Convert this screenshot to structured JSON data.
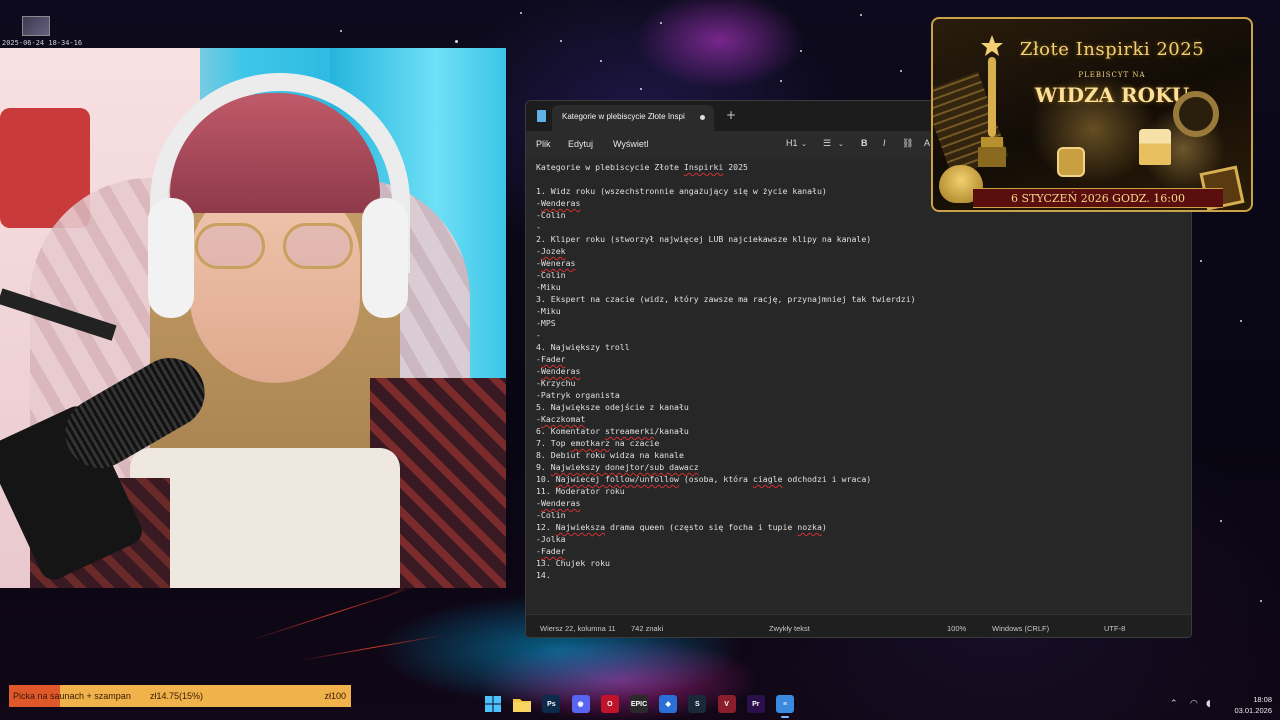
{
  "recording": {
    "timestamp": "2025-06-24 18-34-16"
  },
  "notepad": {
    "tab_title": "Kategorie w plebiscycie Złote Inspi",
    "new_tab": "+",
    "menu": {
      "file": "Plik",
      "edit": "Edytuj",
      "view": "Wyświetl"
    },
    "toolbar": {
      "heading": "H1",
      "list": "☰",
      "bold": "B",
      "italic": "I",
      "link": "⛓",
      "more": "A"
    },
    "lines": [
      [
        {
          "t": "Kategorie w plebiscycie Złote "
        },
        {
          "t": "Inspirki",
          "sq": true
        },
        {
          "t": " 2025"
        }
      ],
      [
        {
          "t": ""
        }
      ],
      [
        {
          "t": "1. Widz roku (wszechstronnie angażujący się w życie kanału)"
        }
      ],
      [
        {
          "t": "-"
        },
        {
          "t": "Wenderas",
          "sq": true
        }
      ],
      [
        {
          "t": "-Colin"
        }
      ],
      [
        {
          "t": "-"
        }
      ],
      [
        {
          "t": "2. Kliper roku (stworzył najwięcej LUB najciekawsze klipy na kanale)"
        }
      ],
      [
        {
          "t": "-"
        },
        {
          "t": "Jozek",
          "sq": true
        }
      ],
      [
        {
          "t": "-"
        },
        {
          "t": "Weneras",
          "sq": true
        }
      ],
      [
        {
          "t": "-Colin"
        }
      ],
      [
        {
          "t": "-Miku"
        }
      ],
      [
        {
          "t": "3. Ekspert na czacie (widz, który zawsze ma rację, przynajmniej tak twierdzi)"
        }
      ],
      [
        {
          "t": "-Miku"
        }
      ],
      [
        {
          "t": "-MPS"
        }
      ],
      [
        {
          "t": "-"
        }
      ],
      [
        {
          "t": "4. Największy troll"
        }
      ],
      [
        {
          "t": "-"
        },
        {
          "t": "Fader",
          "sq": true
        }
      ],
      [
        {
          "t": "-"
        },
        {
          "t": "Wenderas",
          "sq": true
        }
      ],
      [
        {
          "t": "-Krzychu"
        }
      ],
      [
        {
          "t": "-Patryk organista"
        }
      ],
      [
        {
          "t": "5. Największe odejście z kanału"
        }
      ],
      [
        {
          "t": "-"
        },
        {
          "t": "Kaczkomat",
          "sq": true
        }
      ],
      [
        {
          "t": "6. Komentator "
        },
        {
          "t": "streamerki",
          "sq": true
        },
        {
          "t": "/kanału"
        }
      ],
      [
        {
          "t": "7. Top "
        },
        {
          "t": "emotkarz",
          "sq": true
        },
        {
          "t": " na czacie"
        }
      ],
      [
        {
          "t": "8. Debiut roku widza na kanale"
        }
      ],
      [
        {
          "t": "9. "
        },
        {
          "t": "Najwiekszy donejtor/sub dawacz",
          "sq": true
        }
      ],
      [
        {
          "t": "10. "
        },
        {
          "t": "Najwiecej follow/unfollow",
          "sq": true
        },
        {
          "t": " (osoba, która "
        },
        {
          "t": "ciagle",
          "sq": true
        },
        {
          "t": " odchodzi i wraca)"
        }
      ],
      [
        {
          "t": "11. Moderator roku"
        }
      ],
      [
        {
          "t": "-"
        },
        {
          "t": "Wenderas",
          "sq": true
        }
      ],
      [
        {
          "t": "-Colin"
        }
      ],
      [
        {
          "t": "12. "
        },
        {
          "t": "Najwieksza",
          "sq": true
        },
        {
          "t": " drama queen (często się focha i tupie "
        },
        {
          "t": "nozka",
          "sq": true
        },
        {
          "t": ")"
        }
      ],
      [
        {
          "t": "-Jolka"
        }
      ],
      [
        {
          "t": "-"
        },
        {
          "t": "Fader",
          "sq": true
        }
      ],
      [
        {
          "t": "13. Chujek roku"
        }
      ],
      [
        {
          "t": "14."
        }
      ]
    ],
    "status": {
      "position": "Wiersz 22, kolumna 11",
      "chars": "742 znaki",
      "format": "Zwykły tekst",
      "zoom": "100%",
      "line_ending": "Windows (CRLF)",
      "encoding": "UTF-8"
    }
  },
  "banner": {
    "title": "Złote Inspirki 2025",
    "subtitle": "PLEBISCYT NA",
    "headline": "WIDZA ROKU",
    "date": "6 STYCZEŃ 2026   GODZ. 16:00"
  },
  "donation_goal": {
    "label": "Picka na saunach + szampan",
    "amount": "zł14.75(15%)",
    "target": "zł100",
    "progress": 0.15
  },
  "taskbar": {
    "apps": [
      {
        "name": "start-button",
        "icon": "windows-icon",
        "label": "",
        "color": "#3b9cf0"
      },
      {
        "name": "file-explorer",
        "icon": "folder-icon",
        "label": "",
        "color": "#e8b83a"
      },
      {
        "name": "photoshop",
        "icon": "photoshop-icon",
        "label": "Ps",
        "color": "#0d2a4a"
      },
      {
        "name": "discord",
        "icon": "discord-icon",
        "label": "◉",
        "color": "#5865f2"
      },
      {
        "name": "opera",
        "icon": "opera-icon",
        "label": "O",
        "color": "#c0142b"
      },
      {
        "name": "epic-games",
        "icon": "epic-games-icon",
        "label": "EPIC",
        "color": "#2a2a2a"
      },
      {
        "name": "app-blue",
        "icon": "app-icon",
        "label": "◆",
        "color": "#2a6fd8"
      },
      {
        "name": "steam",
        "icon": "steam-icon",
        "label": "S",
        "color": "#1b2838"
      },
      {
        "name": "app-red",
        "icon": "app-icon",
        "label": "V",
        "color": "#8a1e2a"
      },
      {
        "name": "premiere",
        "icon": "premiere-icon",
        "label": "Pr",
        "color": "#2a0f4a"
      },
      {
        "name": "notepad",
        "icon": "notepad-icon",
        "label": "≡",
        "color": "#3a8ae0"
      }
    ],
    "clock_time": "18:08",
    "clock_date": "03.01.2026"
  }
}
